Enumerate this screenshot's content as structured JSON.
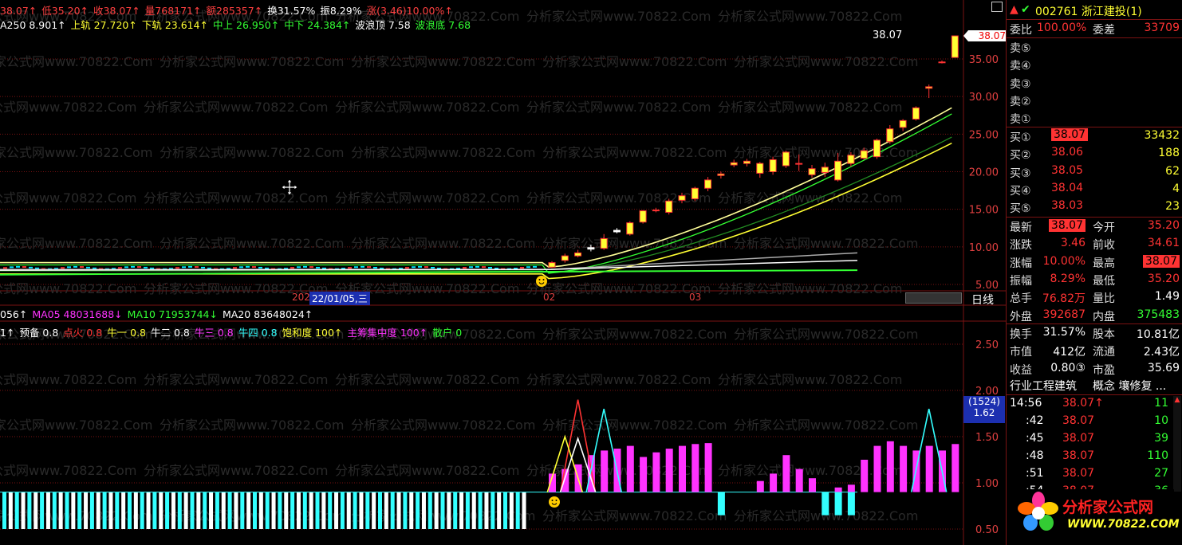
{
  "colors": {
    "up": "#ff3333",
    "down": "#00e5ff",
    "gridRed": "#7a1212",
    "yellow": "#ffff33",
    "green": "#33ff33",
    "magenta": "#ff33ff",
    "white": "#ffffff",
    "cyan": "#33ffff"
  },
  "header": {
    "line1": [
      {
        "t": "38.07↑",
        "c": "#ff4040"
      },
      {
        "t": "低35.20↑",
        "c": "#ff4040"
      },
      {
        "t": "收38.07↑",
        "c": "#ff4040"
      },
      {
        "t": "量768171↑",
        "c": "#ff4040"
      },
      {
        "t": "额285357↑",
        "c": "#ff4040"
      },
      {
        "t": "换31.57%",
        "c": "#ffffff"
      },
      {
        "t": "振8.29%",
        "c": "#ffffff"
      },
      {
        "t": "涨(3.46)10.00%↑",
        "c": "#ff4040"
      }
    ],
    "line2": [
      {
        "t": "A250 8.901↑",
        "c": "#ffffff"
      },
      {
        "t": "上轨 27.720↑",
        "c": "#ffff33"
      },
      {
        "t": "下轨 23.614↑",
        "c": "#ffff33"
      },
      {
        "t": "中上 26.950↑",
        "c": "#33ff33"
      },
      {
        "t": "中下 24.384↑",
        "c": "#33ff33"
      },
      {
        "t": "波浪顶 7.58",
        "c": "#ffffff"
      },
      {
        "t": "波浪底 7.68",
        "c": "#33ff33"
      }
    ],
    "vol_line": [
      {
        "t": "056↑",
        "c": "#ffffff"
      },
      {
        "t": "MA05 48031688↓",
        "c": "#ff33ff"
      },
      {
        "t": "MA10 71953744↓",
        "c": "#33ff33"
      },
      {
        "t": "MA20 83648024↑",
        "c": "#ffffff"
      }
    ],
    "ind_line": [
      {
        "t": "1↑",
        "c": "#ffffff"
      },
      {
        "t": "预备 0.8",
        "c": "#ffffff"
      },
      {
        "t": "点火 0.8",
        "c": "#ff3333"
      },
      {
        "t": "牛一 0.8",
        "c": "#ffff33"
      },
      {
        "t": "牛二 0.8",
        "c": "#ffffff"
      },
      {
        "t": "牛三 0.8",
        "c": "#ff33ff"
      },
      {
        "t": "牛四 0.8",
        "c": "#33ffff"
      },
      {
        "t": "饱和度 100↑",
        "c": "#ffff33"
      },
      {
        "t": "主筹集中度 100↑",
        "c": "#ff33ff"
      },
      {
        "t": "散户 0",
        "c": "#33ff33"
      }
    ]
  },
  "price_axis": [
    "35.00",
    "30.00",
    "25.00",
    "20.00",
    "15.00",
    "10.00",
    "5.00"
  ],
  "price_axis_values": [
    35,
    30,
    25,
    20,
    15,
    10,
    5
  ],
  "price_flag": "38.07",
  "high_label": "38.07",
  "ind_axis": [
    "2.50",
    "2.00",
    "1.50",
    "1.00",
    "0.50"
  ],
  "ind_axis_values": [
    2.5,
    2.0,
    1.5,
    1.0,
    0.5
  ],
  "ind_flag": {
    "count": "(1524)",
    "value": "1.62"
  },
  "date_bar": {
    "cursor_date": "22/01/05,三",
    "left_stub": "2022",
    "label_02": "02",
    "label_03": "03",
    "period": "日线"
  },
  "watermark": "分析家公式网www.70822.Com",
  "chart_data": {
    "type": "candlestick",
    "ylim": [
      5,
      38
    ],
    "flat_count": 84,
    "flat_price": 7.2,
    "candles": [
      {
        "o": 7.3,
        "c": 7.9,
        "h": 8.1,
        "l": 7.2
      },
      {
        "o": 8.2,
        "c": 8.8,
        "h": 9.1,
        "l": 7.9
      },
      {
        "o": 8.8,
        "c": 9.2,
        "h": 9.6,
        "l": 8.6
      },
      {
        "o": 9.9,
        "c": 9.7,
        "h": 10.3,
        "l": 9.4
      },
      {
        "o": 9.8,
        "c": 11.1,
        "h": 11.7,
        "l": 9.6
      },
      {
        "o": 12.2,
        "c": 12.0,
        "h": 12.5,
        "l": 11.8
      },
      {
        "o": 11.7,
        "c": 13.2,
        "h": 13.4,
        "l": 11.5
      },
      {
        "o": 13.3,
        "c": 14.8,
        "h": 14.9,
        "l": 13.1
      },
      {
        "o": 14.9,
        "c": 14.9,
        "h": 15.2,
        "l": 14.6
      },
      {
        "o": 14.6,
        "c": 16.1,
        "h": 16.4,
        "l": 14.3
      },
      {
        "o": 16.2,
        "c": 16.8,
        "h": 17.2,
        "l": 15.8
      },
      {
        "o": 16.4,
        "c": 17.8,
        "h": 18.0,
        "l": 16.1
      },
      {
        "o": 17.8,
        "c": 18.9,
        "h": 19.3,
        "l": 17.4
      },
      {
        "o": 19.5,
        "c": 19.7,
        "h": 20.0,
        "l": 19.1
      },
      {
        "o": 20.9,
        "c": 21.2,
        "h": 21.6,
        "l": 20.6
      },
      {
        "o": 21.1,
        "c": 21.4,
        "h": 21.7,
        "l": 20.7
      },
      {
        "o": 19.8,
        "c": 21.1,
        "h": 21.3,
        "l": 19.2
      },
      {
        "o": 20.0,
        "c": 21.6,
        "h": 22.0,
        "l": 19.6
      },
      {
        "o": 20.8,
        "c": 22.6,
        "h": 22.8,
        "l": 20.5
      },
      {
        "o": 21.1,
        "c": 21.1,
        "h": 22.3,
        "l": 20.1
      },
      {
        "o": 19.6,
        "c": 20.4,
        "h": 20.9,
        "l": 19.2
      },
      {
        "o": 19.9,
        "c": 20.6,
        "h": 21.2,
        "l": 19.3
      },
      {
        "o": 18.9,
        "c": 21.4,
        "h": 22.5,
        "l": 18.7
      },
      {
        "o": 21.1,
        "c": 22.2,
        "h": 22.6,
        "l": 20.7
      },
      {
        "o": 21.8,
        "c": 22.8,
        "h": 23.2,
        "l": 21.6
      },
      {
        "o": 22.0,
        "c": 24.2,
        "h": 24.4,
        "l": 21.7
      },
      {
        "o": 24.0,
        "c": 25.7,
        "h": 26.2,
        "l": 23.7
      },
      {
        "o": 25.9,
        "c": 26.8,
        "h": 27.0,
        "l": 25.4
      },
      {
        "o": 27.0,
        "c": 28.5,
        "h": 28.7,
        "l": 26.8
      },
      {
        "o": 31.1,
        "c": 31.3,
        "h": 31.6,
        "l": 29.8
      },
      {
        "o": 34.6,
        "c": 34.6,
        "h": 34.8,
        "l": 34.4
      },
      {
        "o": 35.2,
        "c": 38.07,
        "h": 38.07,
        "l": 35.2
      }
    ],
    "osc_flat_count": 84,
    "osc_bars": [
      0.2,
      0.25,
      0.3,
      0.4,
      0.45,
      0.47,
      0.5,
      0.38,
      0.43,
      0.47,
      0.5,
      0.52,
      0.53,
      0.0,
      0.0,
      0.0,
      0.12,
      0.2,
      0.4,
      0.25,
      0.15,
      0.0,
      0.05,
      0.08,
      0.35,
      0.5,
      0.55,
      0.5,
      0.45,
      0.5,
      0.45,
      0.52
    ],
    "osc_neg": [
      0,
      0,
      0,
      0,
      0,
      0,
      0,
      0,
      0,
      0,
      0,
      0,
      0,
      -0.25,
      0,
      0,
      0,
      0,
      0,
      0,
      0,
      -0.25,
      -0.25,
      -0.25,
      0,
      0,
      0,
      0,
      0,
      0,
      0,
      0
    ],
    "spikes": [
      {
        "at": 2,
        "value": 1.9,
        "color": "#ff3333"
      },
      {
        "at": 4,
        "value": 1.8,
        "color": "#33ffff"
      },
      {
        "at": 1,
        "value": 1.5,
        "color": "#ffff33"
      },
      {
        "at": 2,
        "value": 1.48,
        "color": "#ffffff"
      },
      {
        "at": 29,
        "value": 1.8,
        "color": "#33ffff"
      }
    ]
  },
  "side": {
    "title": "002761 浙江建投(1)",
    "weibi_label": "委比",
    "weibi": "100.00%",
    "weicha_label": "委差",
    "weicha": "33709",
    "asks": [
      {
        "l": "卖⑤"
      },
      {
        "l": "卖④"
      },
      {
        "l": "卖③"
      },
      {
        "l": "卖②"
      },
      {
        "l": "卖①"
      }
    ],
    "bids": [
      {
        "l": "买①",
        "p": "38.07",
        "v": "33432"
      },
      {
        "l": "买②",
        "p": "38.06",
        "v": "188"
      },
      {
        "l": "买③",
        "p": "38.05",
        "v": "62"
      },
      {
        "l": "买④",
        "p": "38.04",
        "v": "4"
      },
      {
        "l": "买⑤",
        "p": "38.03",
        "v": "23"
      }
    ],
    "quote": [
      {
        "l1": "最新",
        "v1": "38.07",
        "l2": "今开",
        "v2": "35.20",
        "box1": true,
        "box2": false
      },
      {
        "l1": "涨跌",
        "v1": "3.46",
        "l2": "前收",
        "v2": "34.61",
        "box1": false,
        "box2": false
      },
      {
        "l1": "涨幅",
        "v1": "10.00%",
        "l2": "最高",
        "v2": "38.07",
        "box1": false,
        "box2": true
      },
      {
        "l1": "振幅",
        "v1": "8.29%",
        "l2": "最低",
        "v2": "35.20",
        "box1": false,
        "box2": false
      },
      {
        "l1": "总手",
        "v1": "76.82万",
        "l2": "量比",
        "v2": "1.49",
        "box1": false,
        "box2": false
      },
      {
        "l1": "外盘",
        "v1": "392687",
        "l2": "内盘",
        "v2": "375483",
        "box1": false,
        "box2": false
      }
    ],
    "stats": [
      {
        "l1": "换手",
        "v1": "31.57%",
        "l2": "股本",
        "v2": "10.81亿"
      },
      {
        "l1": "市值",
        "v1": "412亿",
        "l2": "流通",
        "v2": "2.43亿"
      },
      {
        "l1": "收益",
        "v1": "0.80③",
        "l2": "市盈",
        "v2": "35.69"
      }
    ],
    "industry": "行业工程建筑",
    "concept": "概念 壤修复 ...",
    "ticks": [
      {
        "t": "14:56",
        "p": "38.07↑",
        "v": "11"
      },
      {
        "t": ":42",
        "p": "38.07",
        "v": "10"
      },
      {
        "t": ":45",
        "p": "38.07",
        "v": "39"
      },
      {
        "t": ":48",
        "p": "38.07",
        "v": "110"
      },
      {
        "t": ":51",
        "p": "38.07",
        "v": "27"
      },
      {
        "t": ":54",
        "p": "38.07",
        "v": "36"
      }
    ]
  },
  "logo": {
    "name": "分析家公式网",
    "url": "WWW.70822.COM"
  }
}
